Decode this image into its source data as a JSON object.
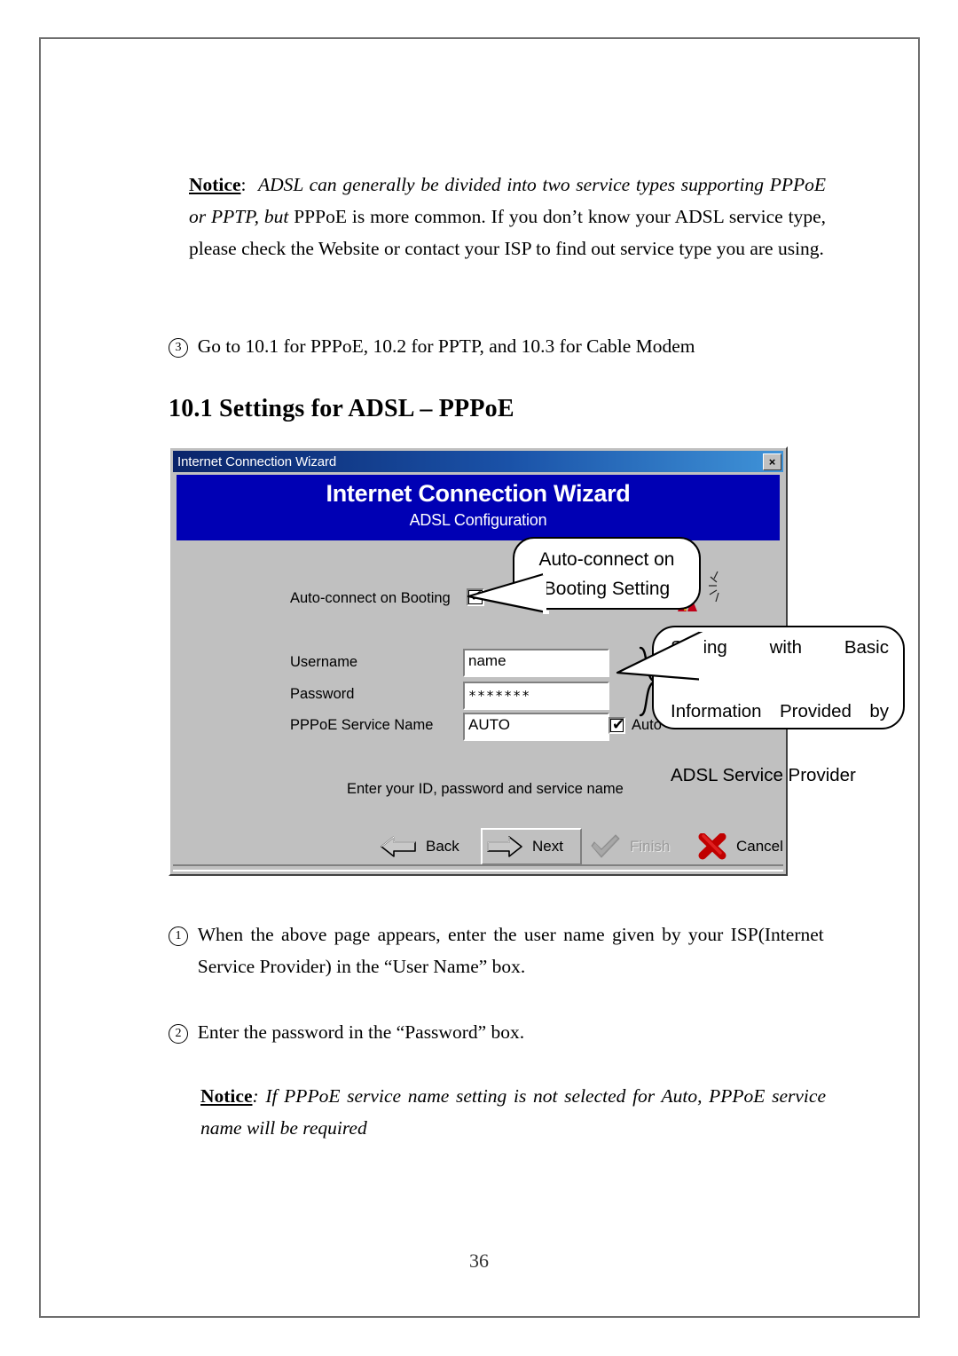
{
  "document": {
    "page_number": "36",
    "notice_1": {
      "label": "Notice",
      "colon": ":",
      "italic_part": "ADSL can generally be divided into two service types supporting PPPoE or PPTP, but",
      "rest": " PPPoE is more common. If you don’t know your ADSL service type, please check the Website or contact your ISP to find out service type you are using."
    },
    "step3": {
      "marker": "3",
      "text": "Go to 10.1 for PPPoE, 10.2 for PPTP, and 10.3 for Cable Modem"
    },
    "section_heading": "10.1 Settings for ADSL – PPPoE",
    "step1": {
      "marker": "1",
      "text": "When the above page appears, enter the user name given by your ISP(Internet Service Provider) in the “User Name” box."
    },
    "step2": {
      "marker": "2",
      "text": "Enter the password in the “Password” box."
    },
    "notice_2": {
      "label": "Notice",
      "colon": ":",
      "text": " If PPPoE service name setting is not selected for Auto, PPPoE service name will be required"
    }
  },
  "wizard": {
    "title_bar": {
      "title": "Internet Connection Wizard",
      "close_label": "×"
    },
    "banner": {
      "title": "Internet Connection Wizard",
      "subtitle": "ADSL Configuration",
      "background_color": "#0000b4"
    },
    "form": {
      "autoconnect": {
        "label": "Auto-connect on Booting",
        "checked": true,
        "check_glyph": "✔"
      },
      "username": {
        "label": "Username",
        "value": "name"
      },
      "password": {
        "label": "Password",
        "value": "*******"
      },
      "service_name": {
        "label": "PPPoE Service Name",
        "value": "AUTO",
        "auto_label": "Auto",
        "auto_checked": true,
        "check_glyph": "✔"
      }
    },
    "hint": "Enter your ID, password and service name",
    "buttons": {
      "back": "Back",
      "next": "Next",
      "finish": "Finish",
      "cancel": "Cancel"
    }
  },
  "callouts": {
    "auto_connect": {
      "line1": "Auto-connect on",
      "line2": "Booting Setting"
    },
    "basic_info": {
      "line1": "Setting with Basic",
      "line2": "Information Provided by",
      "line3": "ADSL Service Provider"
    }
  }
}
